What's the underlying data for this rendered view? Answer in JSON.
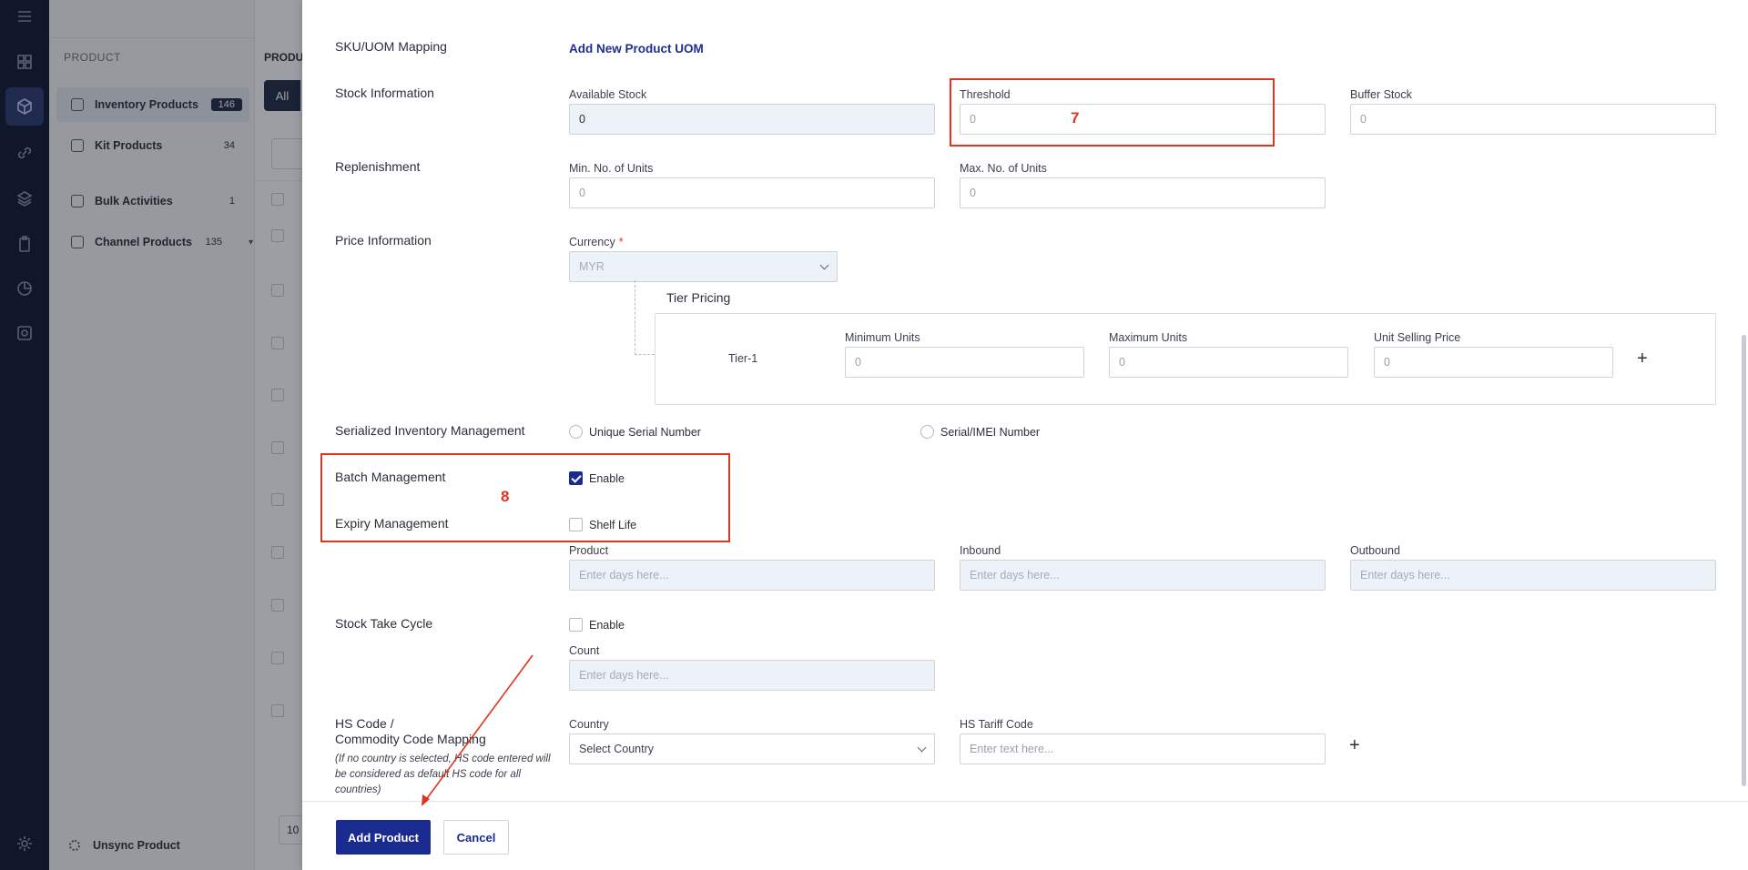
{
  "sidebar": {
    "section": "PRODUCT",
    "items": [
      {
        "label": "Inventory Products",
        "count": "146"
      },
      {
        "label": "Kit Products",
        "count": "34"
      },
      {
        "label": "Bulk Activities",
        "count": "1"
      },
      {
        "label": "Channel Products",
        "count": "135"
      }
    ],
    "unsync": "Unsync Product"
  },
  "background": {
    "header": "PRODU",
    "all_tab": "All",
    "page_size": "10"
  },
  "form": {
    "sku_uom": {
      "label": "SKU/UOM Mapping",
      "link": "Add New Product UOM"
    },
    "stock": {
      "label": "Stock Information",
      "available": {
        "label": "Available Stock",
        "value": "0"
      },
      "threshold": {
        "label": "Threshold",
        "placeholder": "0"
      },
      "buffer": {
        "label": "Buffer Stock",
        "placeholder": "0"
      }
    },
    "replenishment": {
      "label": "Replenishment",
      "min": {
        "label": "Min. No. of Units",
        "placeholder": "0"
      },
      "max": {
        "label": "Max. No. of Units",
        "placeholder": "0"
      }
    },
    "price": {
      "label": "Price Information",
      "currency_label": "Currency",
      "required_mark": "*",
      "currency_value": "MYR",
      "tier_title": "Tier Pricing",
      "tier_name": "Tier-1",
      "min_units": {
        "label": "Minimum Units",
        "placeholder": "0"
      },
      "max_units": {
        "label": "Maximum Units",
        "placeholder": "0"
      },
      "unit_price": {
        "label": "Unit Selling Price",
        "placeholder": "0"
      },
      "add": "+"
    },
    "serialized": {
      "label": "Serialized Inventory Management",
      "opt1": "Unique Serial Number",
      "opt2": "Serial/IMEI Number"
    },
    "batch": {
      "label": "Batch Management",
      "option": "Enable",
      "checked": true
    },
    "expiry": {
      "label": "Expiry Management",
      "option": "Shelf Life",
      "product": {
        "label": "Product",
        "placeholder": "Enter days here..."
      },
      "inbound": {
        "label": "Inbound",
        "placeholder": "Enter days here..."
      },
      "outbound": {
        "label": "Outbound",
        "placeholder": "Enter days here..."
      }
    },
    "stock_take": {
      "label": "Stock Take Cycle",
      "option": "Enable",
      "count": {
        "label": "Count",
        "placeholder": "Enter days here..."
      }
    },
    "hs_code": {
      "label_line1": "HS Code /",
      "label_line2": "Commodity Code Mapping",
      "note": "(If no country is selected, HS code entered will be considered as default HS code for all countries)",
      "country": {
        "label": "Country",
        "value": "Select Country"
      },
      "tariff": {
        "label": "HS Tariff Code",
        "placeholder": "Enter text here..."
      },
      "add": "+"
    }
  },
  "footer": {
    "primary": "Add Product",
    "secondary": "Cancel"
  },
  "annotations": {
    "threshold_num": "7",
    "batch_num": "8"
  },
  "colors": {
    "accent": "#1a2b8f",
    "annotation": "#e0341e",
    "rail": "#0f1830"
  }
}
